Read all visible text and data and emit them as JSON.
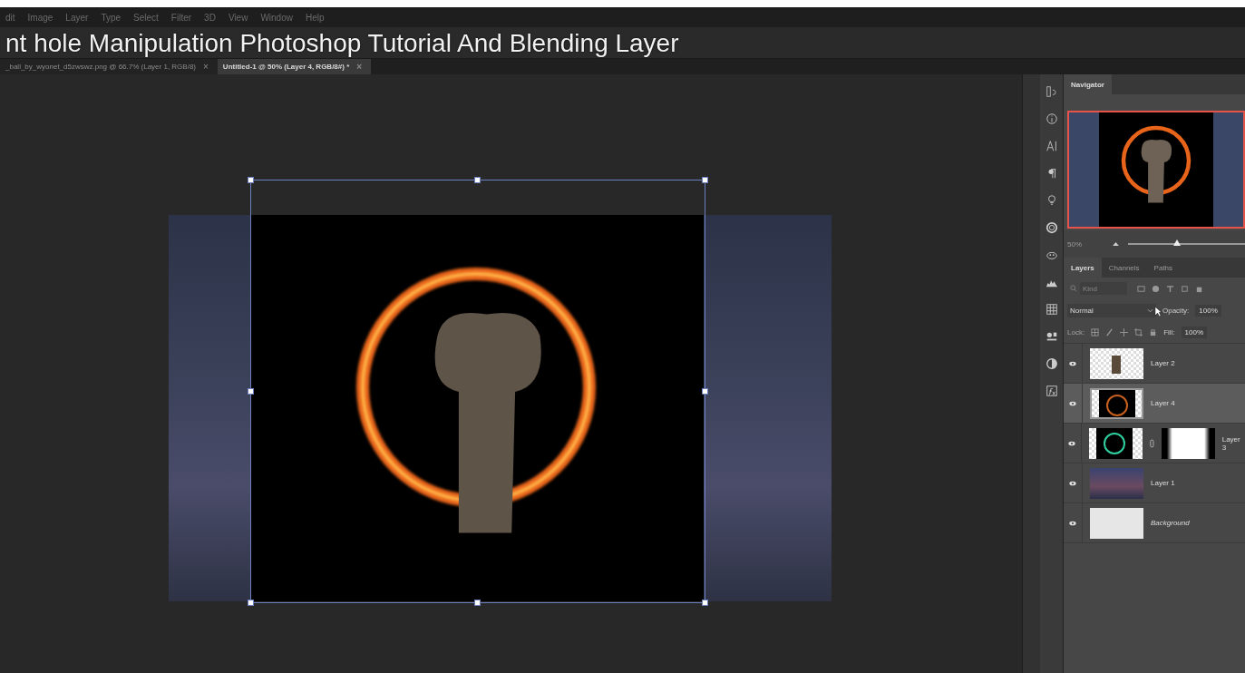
{
  "menu": [
    "dit",
    "Image",
    "Layer",
    "Type",
    "Select",
    "Filter",
    "3D",
    "View",
    "Window",
    "Help"
  ],
  "video_title": "nt hole Manipulation Photoshop Tutorial And Blending Layer",
  "document_tabs": [
    {
      "label": "_ball_by_wyonet_d5zwswz.png @ 66.7% (Layer 1, RGB/8)",
      "close": "×",
      "selected": false
    },
    {
      "label": "Untitled-1 @ 50% (Layer 4, RGB/8#) *",
      "close": "×",
      "selected": true
    }
  ],
  "navigator": {
    "tab": "Navigator",
    "zoom": "50%",
    "level": 0.42
  },
  "layers_panel": {
    "tabs": [
      {
        "label": "Layers",
        "selected": true
      },
      {
        "label": "Channels",
        "selected": false
      },
      {
        "label": "Paths",
        "selected": false
      }
    ],
    "filter_placeholder": "Kind",
    "blend_mode": "Normal",
    "opacity_label": "Opacity:",
    "opacity": "100%",
    "lock_label": "Lock:",
    "fill_label": "Fill:",
    "fill": "100%",
    "layers": [
      {
        "name": "Layer 2",
        "kind": "elephant",
        "visible": true,
        "selected": false,
        "mask": false
      },
      {
        "name": "Layer 4",
        "kind": "ring",
        "visible": true,
        "selected": true,
        "mask": false
      },
      {
        "name": "Layer 3",
        "kind": "greenring",
        "visible": true,
        "selected": false,
        "mask": true
      },
      {
        "name": "Layer 1",
        "kind": "city",
        "visible": true,
        "selected": false,
        "mask": false
      },
      {
        "name": "Background",
        "kind": "background",
        "visible": true,
        "selected": false,
        "mask": false
      }
    ]
  }
}
